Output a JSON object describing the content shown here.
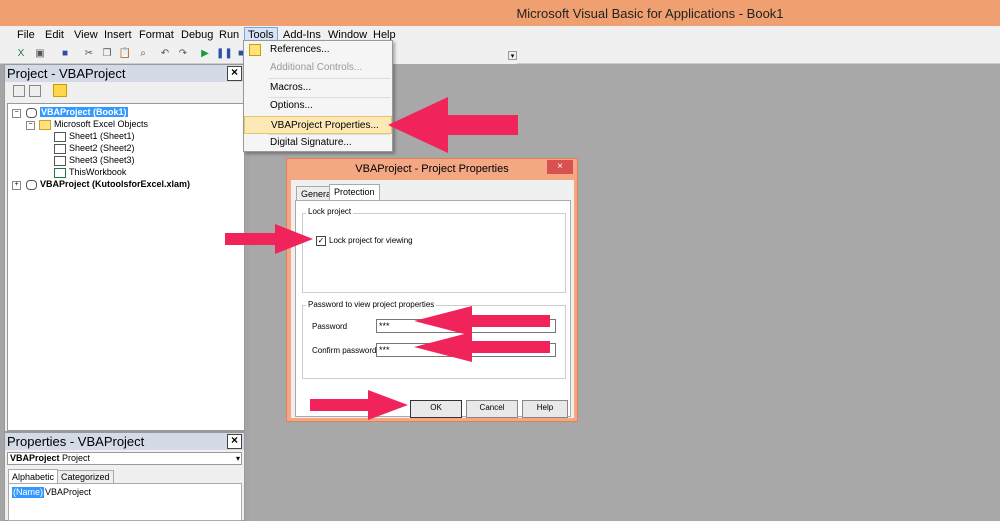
{
  "window": {
    "title": "Microsoft Visual Basic for Applications - Book1"
  },
  "menubar": [
    {
      "label": "File"
    },
    {
      "label": "Edit"
    },
    {
      "label": "View"
    },
    {
      "label": "Insert"
    },
    {
      "label": "Format"
    },
    {
      "label": "Debug"
    },
    {
      "label": "Run"
    },
    {
      "label": "Tools"
    },
    {
      "label": "Add-Ins"
    },
    {
      "label": "Window"
    },
    {
      "label": "Help"
    }
  ],
  "tools_menu": {
    "items": [
      {
        "label": "References...",
        "enabled": true
      },
      {
        "label": "Additional Controls...",
        "enabled": false
      },
      {
        "label": "Macros...",
        "enabled": true
      },
      {
        "label": "Options...",
        "enabled": true
      },
      {
        "label": "VBAProject Properties...",
        "enabled": true,
        "highlighted": true
      },
      {
        "label": "Digital Signature...",
        "enabled": true
      }
    ]
  },
  "project_panel": {
    "title": "Project - VBAProject",
    "tree": {
      "project1": "VBAProject (Book1)",
      "folder": "Microsoft Excel Objects",
      "sheet1": "Sheet1 (Sheet1)",
      "sheet2": "Sheet2 (Sheet2)",
      "sheet3": "Sheet3 (Sheet3)",
      "workbook": "ThisWorkbook",
      "project2": "VBAProject (KutoolsforExcel.xlam)"
    }
  },
  "properties_panel": {
    "title": "Properties - VBAProject",
    "object_name": "VBAProject",
    "object_type": "Project",
    "tabs": [
      "Alphabetic",
      "Categorized"
    ],
    "row_name": "(Name)",
    "row_value": "VBAProject"
  },
  "dialog": {
    "title": "VBAProject - Project Properties",
    "tabs": [
      "General",
      "Protection"
    ],
    "lock_group": "Lock project",
    "lock_label": "Lock project for viewing",
    "lock_checked": true,
    "password_group": "Password to view project properties",
    "password_label": "Password",
    "password_value": "***",
    "confirm_label": "Confirm password",
    "confirm_value": "***",
    "buttons": {
      "ok": "OK",
      "cancel": "Cancel",
      "help": "Help"
    }
  },
  "colors": {
    "title_bar": "#f0a070",
    "dialog_frame": "#f3a883",
    "arrow": "#f0245a",
    "selection": "#3399ff"
  }
}
